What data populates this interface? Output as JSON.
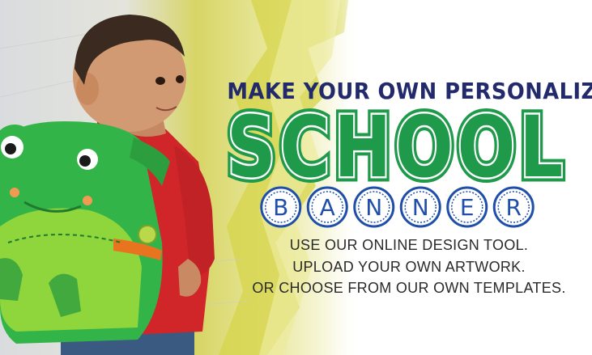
{
  "headline": {
    "top_line": "MAKE YOUR OWN PERSONALIZED",
    "main_word": "SCHOOL",
    "banner_letters": [
      "B",
      "A",
      "N",
      "N",
      "E",
      "R"
    ]
  },
  "taglines": [
    "USE OUR ONLINE DESIGN TOOL.",
    "UPLOAD YOUR OWN ARTWORK.",
    "OR CHOOSE FROM OUR OWN TEMPLATES."
  ],
  "colors": {
    "navy": "#222a6b",
    "green": "#1f9a4a",
    "blue": "#1f4fa8",
    "paint_yellow": "#d8d84a"
  },
  "photo": {
    "subject": "boy-with-frog-backpack"
  }
}
